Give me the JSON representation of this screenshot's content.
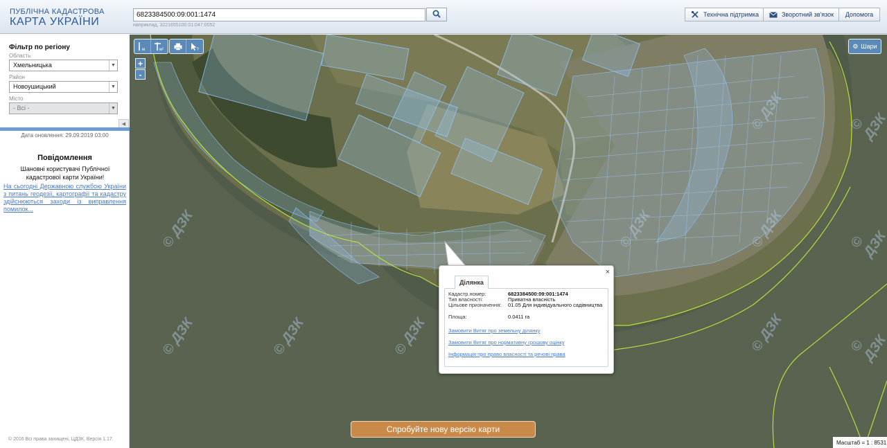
{
  "header": {
    "logo_line1": "ПУБЛІЧНА КАДАСТРОВА",
    "logo_line2": "КАРТА УКРАЇНИ",
    "search_value": "6823384500:09:001:1474",
    "search_hint": "наприклад, 3221655100:01:047:0052",
    "buttons": {
      "support": "Технічна підтримка",
      "feedback": "Зворотний зв'язок",
      "help": "Допомога"
    }
  },
  "sidebar": {
    "filter_title": "Фільтр по регіону",
    "region_label": "Область",
    "region_value": "Хмельницька",
    "district_label": "Район",
    "district_value": "Новоушицький",
    "city_label": "Місто",
    "city_value": "- Всі -",
    "update_date": "Дата оновлення: 29.09.2019 03:00",
    "notice_title": "Повідомлення",
    "notice_text": "Шановні користувачі Публічної кадастрової карти України!",
    "notice_link": "На сьогодні Державною службою України з питань геодезії, картографії та кадастру здійснюються заходи із виправлення помилок...",
    "copyright": "© 2016 Всі права захищені, ЦДЗК, Версія 1.17."
  },
  "map": {
    "toolbar_measure_line_label": "м",
    "toolbar_measure_area_label": "м²",
    "zoom_in": "+",
    "zoom_out": "-",
    "layers_label": "Шари",
    "watermark_text": "© ДЗК",
    "new_version": "Спробуйте нову версію карти",
    "scale": "Масштаб = 1 : 8531"
  },
  "popup": {
    "tab": "Ділянка",
    "close": "×",
    "rows": [
      {
        "label": "Кадастр.номер:",
        "value": "6823384500:09:001:1474"
      },
      {
        "label": "Тип власності:",
        "value": "Приватна власність"
      },
      {
        "label": "Цільове призначення:",
        "value": "01.05 Для індивідуального садівництва"
      },
      {
        "label": "Площа:",
        "value": "0.0411 га"
      }
    ],
    "links": [
      "Замовити Витяг про земельну ділянку",
      "Замовити Витяг про нормативну грошову оцінку",
      "Інформація про право власності та речові права"
    ]
  },
  "colors": {
    "header_text": "#2a5a95",
    "tool_bg": "#5c8ab8",
    "link": "#4a79c4",
    "new_version_bg": "#c98a49",
    "parcel_stroke": "#8fc1f2",
    "border_line": "#b6e03c"
  }
}
